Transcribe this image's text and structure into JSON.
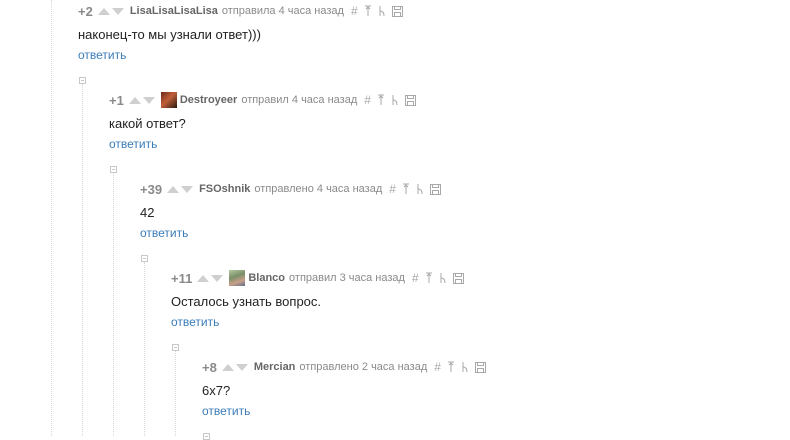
{
  "reply_label": "ответить",
  "comments": [
    {
      "rating": "+2",
      "author": "LisaLisaLisaLisa",
      "verb": "отправила",
      "time": "4 часа назад",
      "text": "наконец-то мы узнали ответ)))",
      "has_avatar": false
    },
    {
      "rating": "+1",
      "author": "Destroyeer",
      "verb": "отправил",
      "time": "4 часа назад",
      "text": "какой ответ?",
      "has_avatar": true
    },
    {
      "rating": "+39",
      "author": "FSOshnik",
      "verb": "отправлено",
      "time": "4 часа назад",
      "text": "42",
      "has_avatar": false
    },
    {
      "rating": "+11",
      "author": "Blanco",
      "verb": "отправил",
      "time": "3 часа назад",
      "text": "Осталось узнать вопрос.",
      "has_avatar": true
    },
    {
      "rating": "+8",
      "author": "Mercian",
      "verb": "отправлено",
      "time": "2 часа назад",
      "text": "6x7?",
      "has_avatar": false
    }
  ],
  "icons": [
    "hash-icon",
    "parent-arrow-icon",
    "branch-icon",
    "save-icon"
  ]
}
